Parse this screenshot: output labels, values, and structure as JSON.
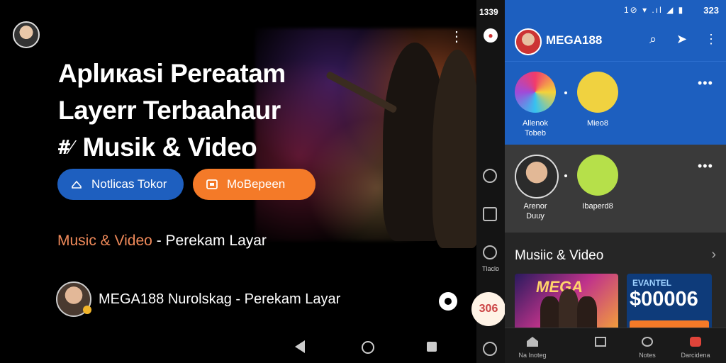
{
  "hero": {
    "line1": "Aplикasi Pereatam",
    "line2": "Layerr Terbaahaur",
    "line3_icon": "#⁄",
    "line3": "Musik & Video",
    "btn_primary": "Notlicas Tokor",
    "btn_secondary": "MoBepeen",
    "subtitle_accent": "Music & Video",
    "subtitle_rest": " - Perekam Layar",
    "channel": "MEGA188 Nurolskag - Perekam Layar"
  },
  "rail": {
    "time": "1339",
    "label": "Tlaclo",
    "fab": "306"
  },
  "phone": {
    "status_time": "323",
    "status_icons": "1⊘ ▾ .ıl ◢ ▮",
    "app_title": "MEGA188",
    "story1_label": "Allenok\nTobeb",
    "story2_label": "Mieo8",
    "story3_label": "Arenor\nDuuy",
    "story4_label": "Ibaperd8",
    "section_title": "Musiic & Video",
    "card1_text": "MEGA",
    "card2_kicker": "EVANTEL",
    "card2_amount": "$00006",
    "nav1": "Na Inoteg",
    "nav2": "",
    "nav3": "Notes",
    "nav4": "Darcidena"
  }
}
